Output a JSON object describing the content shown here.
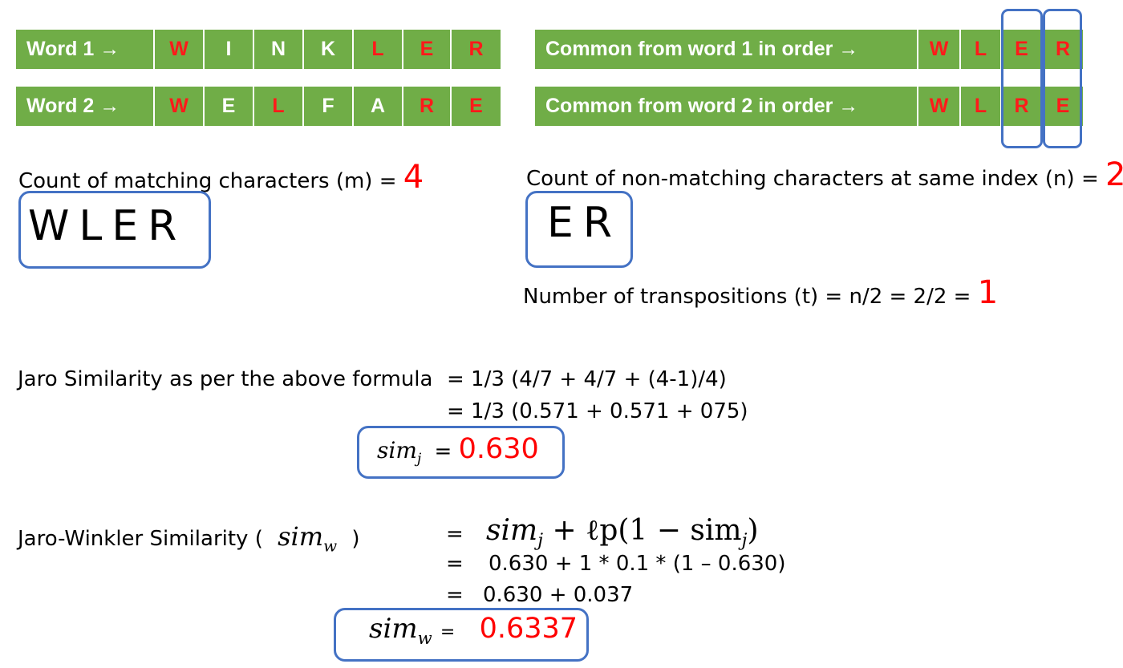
{
  "word1": {
    "label": "Word 1 →",
    "letters": [
      "W",
      "I",
      "N",
      "K",
      "L",
      "E",
      "R"
    ],
    "red": [
      true,
      false,
      false,
      false,
      true,
      true,
      true
    ]
  },
  "word2": {
    "label": "Word 2 →",
    "letters": [
      "W",
      "E",
      "L",
      "F",
      "A",
      "R",
      "E"
    ],
    "red": [
      true,
      false,
      true,
      false,
      false,
      true,
      true
    ]
  },
  "common1": {
    "label": "Common from word 1 in order →",
    "letters": [
      "W",
      "L",
      "E",
      "R"
    ]
  },
  "common2": {
    "label": "Common from word 2 in order →",
    "letters": [
      "W",
      "L",
      "R",
      "E"
    ]
  },
  "matching": {
    "text": "Count of matching characters (m) = ",
    "value": "4",
    "chars": "WLER"
  },
  "nonmatching": {
    "text": "Count of non-matching characters at same index (n) = ",
    "value": "2",
    "chars": "ER"
  },
  "transpositions": {
    "text": "Number of transpositions (t) = n/2  = 2/2 = ",
    "value": "1"
  },
  "jaro": {
    "label": "Jaro Similarity as per the above formula",
    "line1": "= 1/3 (4/7 + 4/7 + (4-1)/4)",
    "line2": "= 1/3 (0.571 + 0.571 + 075)",
    "sym": "sim",
    "sub": "j",
    "eq": "=",
    "result": "0.630"
  },
  "winkler": {
    "label_prefix": "Jaro-Winkler Similarity (",
    "label_suffix": ")",
    "sym": "sim",
    "sub": "w",
    "eq1": "=",
    "formula_a": "sim",
    "formula_a_sub": "j",
    "formula_b": " + ℓp(1 − sim",
    "formula_b_sub": "j",
    "formula_c": ")",
    "eq2": "=",
    "line2": "0.630 + 1 * 0.1 * (1 – 0.630)",
    "eq3": "=",
    "line3": "0.630 + 0.037",
    "result_eq": "=",
    "result": "0.6337"
  },
  "colors": {
    "band_green": "#70ad47",
    "highlight_red": "#ff0000",
    "box_blue": "#4472c4"
  }
}
